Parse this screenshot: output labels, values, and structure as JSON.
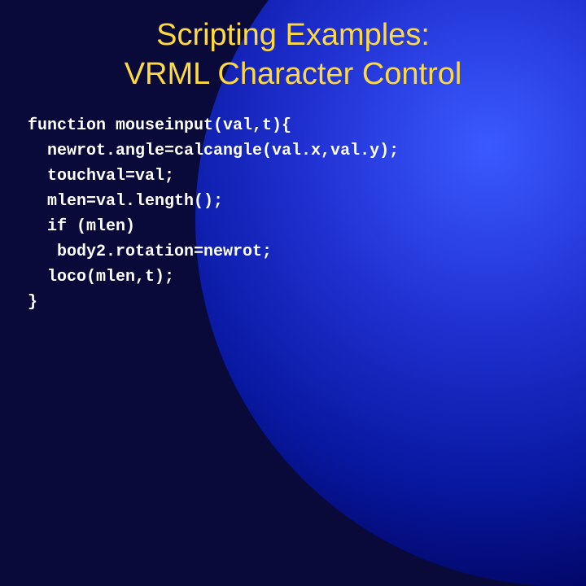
{
  "slide": {
    "title_line1": "Scripting Examples:",
    "title_line2": "VRML Character Control",
    "code": {
      "l1": "function mouseinput(val,t){",
      "l2": "  newrot.angle=calcangle(val.x,val.y);",
      "l3": "  touchval=val;",
      "l4": "  mlen=val.length();",
      "l5": "  if (mlen)",
      "l6": "   body2.rotation=newrot;",
      "l7": "  loco(mlen,t);",
      "l8": "}"
    }
  }
}
